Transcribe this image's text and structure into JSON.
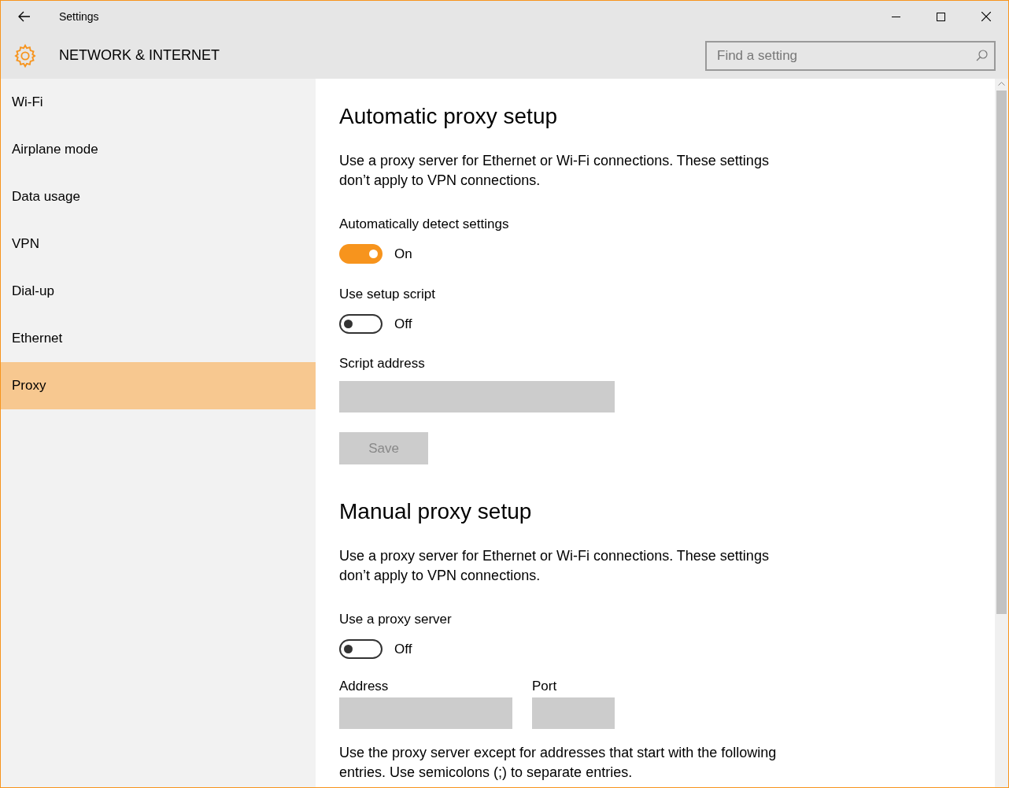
{
  "window": {
    "title": "Settings"
  },
  "header": {
    "title": "NETWORK & INTERNET",
    "search": {
      "placeholder": "Find a setting"
    }
  },
  "sidebar": {
    "items": [
      {
        "label": "Wi-Fi",
        "selected": false
      },
      {
        "label": "Airplane mode",
        "selected": false
      },
      {
        "label": "Data usage",
        "selected": false
      },
      {
        "label": "VPN",
        "selected": false
      },
      {
        "label": "Dial-up",
        "selected": false
      },
      {
        "label": "Ethernet",
        "selected": false
      },
      {
        "label": "Proxy",
        "selected": true
      }
    ]
  },
  "content": {
    "sections": [
      {
        "heading": "Automatic proxy setup",
        "items": [
          {
            "kind": "paragraph",
            "text": "Use a proxy server for Ethernet or Wi-Fi connections. These settings don’t apply to VPN connections."
          },
          {
            "kind": "toggle",
            "label": "Automatically detect settings",
            "on": true,
            "state_text": "On"
          },
          {
            "kind": "toggle",
            "label": "Use setup script",
            "on": false,
            "state_text": "Off"
          },
          {
            "kind": "field",
            "label": "Script address"
          },
          {
            "kind": "button",
            "label": "Save",
            "disabled": true
          }
        ]
      },
      {
        "heading": "Manual proxy setup",
        "items": [
          {
            "kind": "paragraph",
            "text": "Use a proxy server for Ethernet or Wi-Fi connections. These settings don’t apply to VPN connections."
          },
          {
            "kind": "toggle",
            "label": "Use a proxy server",
            "on": false,
            "state_text": "Off"
          },
          {
            "kind": "field_pair",
            "fields": [
              {
                "label": "Address"
              },
              {
                "label": "Port"
              }
            ]
          },
          {
            "kind": "paragraph",
            "text": "Use the proxy server except for addresses that start with the following entries. Use semicolons (;) to separate entries."
          }
        ]
      }
    ]
  }
}
